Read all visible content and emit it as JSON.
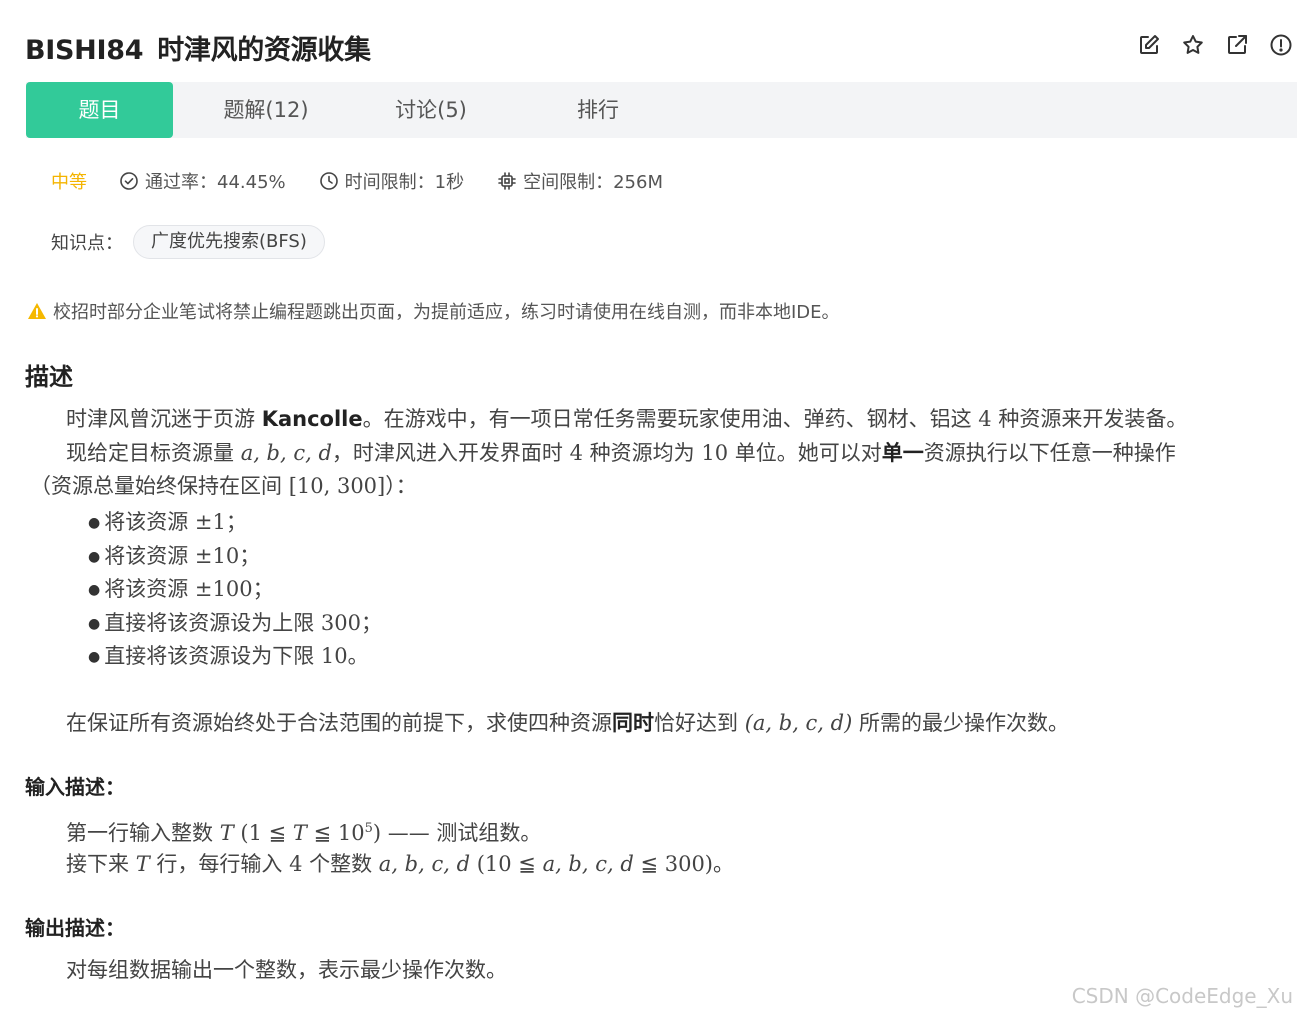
{
  "problem": {
    "id": "BISHI84",
    "title": "时津风的资源收集"
  },
  "header_icons": [
    "edit-icon",
    "star-icon",
    "share-icon",
    "report-icon"
  ],
  "tabs": [
    {
      "label": "题目",
      "active": true
    },
    {
      "label": "题解(12)",
      "active": false
    },
    {
      "label": "讨论(5)",
      "active": false
    },
    {
      "label": "排行",
      "active": false
    }
  ],
  "meta": {
    "difficulty": "中等",
    "pass_rate": "通过率：44.45%",
    "time_limit": "时间限制：1秒",
    "memory_limit": "空间限制：256M"
  },
  "knowledge": {
    "label": "知识点：",
    "tags": [
      "广度优先搜索(BFS)"
    ]
  },
  "warning": "校招时部分企业笔试将禁止编程题跳出页面，为提前适应，练习时请使用在线自测，而非本地IDE。",
  "description": {
    "heading": "描述",
    "p1_a": "时津风曾沉迷于页游 ",
    "p1_bold": "Kancolle",
    "p1_b": "。在游戏中，有一项日常任务需要玩家使用油、弹药、钢材、铝这 ",
    "p1_num": "4",
    "p1_c": " 种资源来开发装备。",
    "p2_a": "现给定目标资源量 ",
    "p2_vars": "a, b, c, d",
    "p2_b": "，时津风进入开发界面时 ",
    "p2_num1": "4",
    "p2_c": " 种资源均为 ",
    "p2_num2": "10",
    "p2_d": " 单位。她可以对",
    "p2_bold": "单一",
    "p2_e": "资源执行以下任意一种操作",
    "p3_a": "（资源总量始终保持在区间 ",
    "p3_math": "[10, 300]",
    "p3_b": "）：",
    "bullets": [
      {
        "text": "将该资源 ",
        "math": "±1",
        "end": "；"
      },
      {
        "text": "将该资源 ",
        "math": "±10",
        "end": "；"
      },
      {
        "text": "将该资源 ",
        "math": "±100",
        "end": "；"
      },
      {
        "text": "直接将该资源设为上限 ",
        "math": "300",
        "end": "；"
      },
      {
        "text": "直接将该资源设为下限 ",
        "math": "10",
        "end": "。"
      }
    ],
    "p4_a": "在保证所有资源始终处于合法范围的前提下，求使四种资源",
    "p4_bold": "同时",
    "p4_b": "恰好达到 ",
    "p4_math": "(a, b, c, d)",
    "p4_c": " 所需的最少操作次数。"
  },
  "input": {
    "heading": "输入描述：",
    "l1_a": "第一行输入整数 ",
    "l1_T": "T",
    "l1_range_a": "(1 ≦ ",
    "l1_range_T": "T",
    "l1_range_b": " ≦ 10",
    "l1_exp": "5",
    "l1_range_c": ")",
    "l1_b": " —— 测试组数。",
    "l2_a": "接下来 ",
    "l2_T": "T",
    "l2_b": " 行，每行输入 ",
    "l2_num": "4",
    "l2_c": " 个整数 ",
    "l2_vars": "a, b, c, d",
    "l2_range_a": " (10 ≦ ",
    "l2_range_vars": "a, b, c, d",
    "l2_range_b": " ≦ 300)",
    "l2_d": "。"
  },
  "output": {
    "heading": "输出描述：",
    "text": "对每组数据输出一个整数，表示最少操作次数。"
  },
  "watermark": "CSDN @CodeEdge_Xu",
  "colors": {
    "accent": "#32ca99",
    "difficulty": "#f4b400",
    "warning": "#f5b800"
  }
}
